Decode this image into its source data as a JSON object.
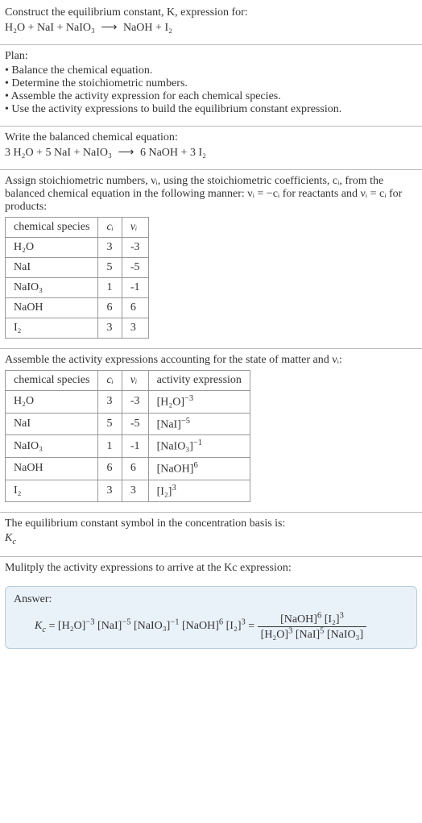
{
  "prompt": {
    "line1": "Construct the equilibrium constant, K, expression for:",
    "equation_lhs": [
      "H₂O",
      "NaI",
      "NaIO₃"
    ],
    "equation_rhs": [
      "NaOH",
      "I₂"
    ]
  },
  "plan": {
    "heading": "Plan:",
    "items": [
      "Balance the chemical equation.",
      "Determine the stoichiometric numbers.",
      "Assemble the activity expression for each chemical species.",
      "Use the activity expressions to build the equilibrium constant expression."
    ]
  },
  "balanced": {
    "intro": "Write the balanced chemical equation:",
    "lhs": [
      {
        "coef": "3",
        "species": "H₂O"
      },
      {
        "coef": "5",
        "species": "NaI"
      },
      {
        "coef": "",
        "species": "NaIO₃"
      }
    ],
    "rhs": [
      {
        "coef": "6",
        "species": "NaOH"
      },
      {
        "coef": "3",
        "species": "I₂"
      }
    ]
  },
  "stoich": {
    "intro1": "Assign stoichiometric numbers, νᵢ, using the stoichiometric coefficients, cᵢ, from the balanced chemical equation in the following manner: νᵢ = −cᵢ for reactants and νᵢ = cᵢ for products:",
    "headers": [
      "chemical species",
      "cᵢ",
      "νᵢ"
    ],
    "rows": [
      {
        "species": "H₂O",
        "c": "3",
        "v": "-3"
      },
      {
        "species": "NaI",
        "c": "5",
        "v": "-5"
      },
      {
        "species": "NaIO₃",
        "c": "1",
        "v": "-1"
      },
      {
        "species": "NaOH",
        "c": "6",
        "v": "6"
      },
      {
        "species": "I₂",
        "c": "3",
        "v": "3"
      }
    ]
  },
  "activities": {
    "intro": "Assemble the activity expressions accounting for the state of matter and νᵢ:",
    "headers": [
      "chemical species",
      "cᵢ",
      "νᵢ",
      "activity expression"
    ],
    "rows": [
      {
        "species": "H₂O",
        "c": "3",
        "v": "-3",
        "expr_base": "[H₂O]",
        "expr_exp": "−3"
      },
      {
        "species": "NaI",
        "c": "5",
        "v": "-5",
        "expr_base": "[NaI]",
        "expr_exp": "−5"
      },
      {
        "species": "NaIO₃",
        "c": "1",
        "v": "-1",
        "expr_base": "[NaIO₃]",
        "expr_exp": "−1"
      },
      {
        "species": "NaOH",
        "c": "6",
        "v": "6",
        "expr_base": "[NaOH]",
        "expr_exp": "6"
      },
      {
        "species": "I₂",
        "c": "3",
        "v": "3",
        "expr_base": "[I₂]",
        "expr_exp": "3"
      }
    ]
  },
  "ksymbol": {
    "intro": "The equilibrium constant symbol in the concentration basis is:",
    "symbol": "K",
    "sub": "c"
  },
  "multiply": {
    "intro": "Mulitply the activity expressions to arrive at the Kc expression:"
  },
  "answer": {
    "title": "Answer:",
    "lhs_sym": "K",
    "lhs_sub": "c",
    "product_terms": [
      {
        "base": "[H₂O]",
        "exp": "−3"
      },
      {
        "base": "[NaI]",
        "exp": "−5"
      },
      {
        "base": "[NaIO₃]",
        "exp": "−1"
      },
      {
        "base": "[NaOH]",
        "exp": "6"
      },
      {
        "base": "[I₂]",
        "exp": "3"
      }
    ],
    "frac_num": [
      {
        "base": "[NaOH]",
        "exp": "6"
      },
      {
        "base": "[I₂]",
        "exp": "3"
      }
    ],
    "frac_den": [
      {
        "base": "[H₂O]",
        "exp": "3"
      },
      {
        "base": "[NaI]",
        "exp": "5"
      },
      {
        "base": "[NaIO₃]",
        "exp": ""
      }
    ]
  }
}
